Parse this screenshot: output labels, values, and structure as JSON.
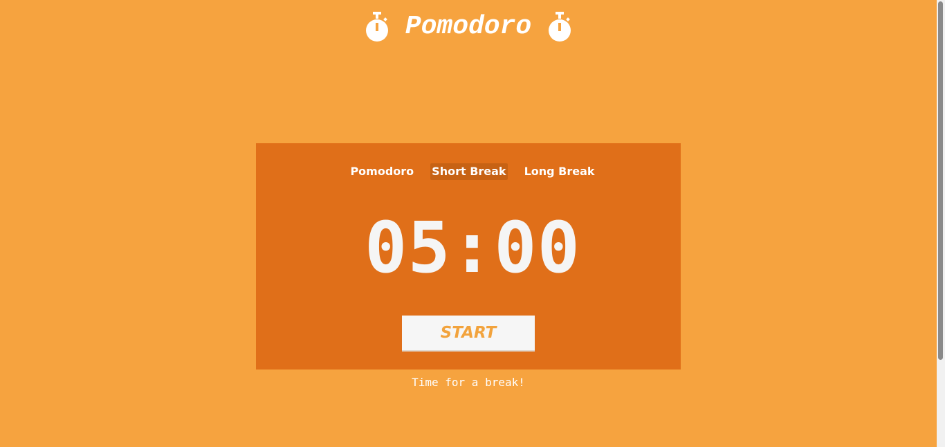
{
  "header": {
    "title": "Pomodoro",
    "left_icon": "stopwatch-icon",
    "right_icon": "stopwatch-icon"
  },
  "timer": {
    "tabs": [
      {
        "label": "Pomodoro",
        "active": false
      },
      {
        "label": "Short Break",
        "active": true
      },
      {
        "label": "Long Break",
        "active": false
      }
    ],
    "time": "05:00",
    "start_label": "START"
  },
  "message": "Time for a break!",
  "colors": {
    "background": "#f6a33f",
    "card": "#e06f19",
    "active_tab": "#c76214",
    "button_text": "#f2a33d"
  }
}
